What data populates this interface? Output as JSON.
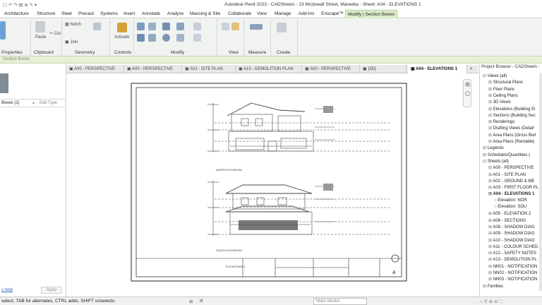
{
  "window": {
    "title": "Autodesk Revit 2023 - CADSheets - 23 Mcdowall Street, Mareeba - Sheet: A04 - ELEVATIONS 1"
  },
  "ribbon_tabs": [
    "Architecture",
    "Structure",
    "Steel",
    "Precast",
    "Systems",
    "Insert",
    "Annotate",
    "Analyze",
    "Massing & Site",
    "Collaborate",
    "View",
    "Manage",
    "Add-Ins",
    "Enscape™",
    "Modify | Section Boxes"
  ],
  "ribbon": {
    "groups": {
      "properties": "Properties",
      "clipboard": "Clipboard",
      "geometry": "Geometry",
      "controls": "Controls",
      "modify": "Modify",
      "view": "View",
      "measure": "Measure",
      "create": "Create"
    },
    "buttons": {
      "paste": "Paste",
      "cut": "Cut",
      "join": "Join",
      "notch": "Notch",
      "activate": "Activate"
    }
  },
  "options_bar": {
    "label": "Section Boxes"
  },
  "properties": {
    "type_selector": "Boxes (1)",
    "edit_type": "Edit Type",
    "help_link": "s help",
    "apply": "Apply"
  },
  "view_tabs": [
    {
      "label": "A00 - PERSPECTIVE",
      "active": false
    },
    {
      "label": "A00 - PERSPECTIVE",
      "active": false
    },
    {
      "label": "A01 - SITE PLAN",
      "active": false
    },
    {
      "label": "A13 - DEMOLITION PLAN",
      "active": false
    },
    {
      "label": "A00 - PERSPECTIVE",
      "active": false
    },
    {
      "label": "{3D}",
      "active": false
    },
    {
      "label": "A04 - ELEVATIONS 1",
      "active": true
    }
  ],
  "sheet": {
    "north_elevation": "NORTH ELEVATION",
    "south_elevation": "SOUTH ELEVATION",
    "title_block_name": "ELEVATIONS 1",
    "sheet_letter": "A"
  },
  "project_browser": {
    "title": "Project Browser - CADSheets -",
    "items": [
      {
        "label": "Views (all)",
        "level": 0,
        "expanded": true
      },
      {
        "label": "Structural Plans",
        "level": 1
      },
      {
        "label": "Floor Plans",
        "level": 1
      },
      {
        "label": "Ceiling Plans",
        "level": 1
      },
      {
        "label": "3D Views",
        "level": 1
      },
      {
        "label": "Elevations (Building El",
        "level": 1
      },
      {
        "label": "Sections (Building Sec",
        "level": 1
      },
      {
        "label": "Renderings",
        "level": 1
      },
      {
        "label": "Drafting Views (Detail",
        "level": 1
      },
      {
        "label": "Area Plans (Gross Buil",
        "level": 1
      },
      {
        "label": "Area Plans (Rentable)",
        "level": 1
      },
      {
        "label": "Legends",
        "level": 0
      },
      {
        "label": "Schedules/Quantities (",
        "level": 0
      },
      {
        "label": "Sheets (all)",
        "level": 0,
        "expanded": true
      },
      {
        "label": "A00 - PERSPECTIVE",
        "level": 1
      },
      {
        "label": "A01 - SITE PLAN",
        "level": 1
      },
      {
        "label": "A02 - GROUND & ME",
        "level": 1
      },
      {
        "label": "A03 - FIRST FLOOR PL",
        "level": 1
      },
      {
        "label": "A04 - ELEVATIONS 1",
        "level": 1,
        "bold": true
      },
      {
        "label": "Elevation: NOR",
        "level": 2
      },
      {
        "label": "Elevation: SOU",
        "level": 2
      },
      {
        "label": "A05 - ELEVATION 2",
        "level": 1
      },
      {
        "label": "A06 - SECTIONS",
        "level": 1
      },
      {
        "label": "A08 - SHADOW DIAG",
        "level": 1
      },
      {
        "label": "A09 - SHADOW DIAG",
        "level": 1
      },
      {
        "label": "A10 - SHADOW DIAG",
        "level": 1
      },
      {
        "label": "A11 - COLOUR SCHED",
        "level": 1
      },
      {
        "label": "A12 - SAFETY NOTES",
        "level": 1
      },
      {
        "label": "A13 - DEMOLITION PL",
        "level": 1
      },
      {
        "label": "NN01 - NOTIFICATION",
        "level": 1
      },
      {
        "label": "NN02 - NOTIFICATION",
        "level": 1
      },
      {
        "label": "NN03 - NOTIFICATION",
        "level": 1
      },
      {
        "label": "Families",
        "level": 0
      }
    ]
  },
  "status": {
    "hint": "select, TAB for alternates, CTRL adds, SHIFT unselects.",
    "model": "Main Model",
    "scale": ":0"
  },
  "colors": {
    "accent_tab": "#dcedc8",
    "options_bar": "#e4f0d2",
    "ribbon_bg": "#f1f3f1"
  }
}
